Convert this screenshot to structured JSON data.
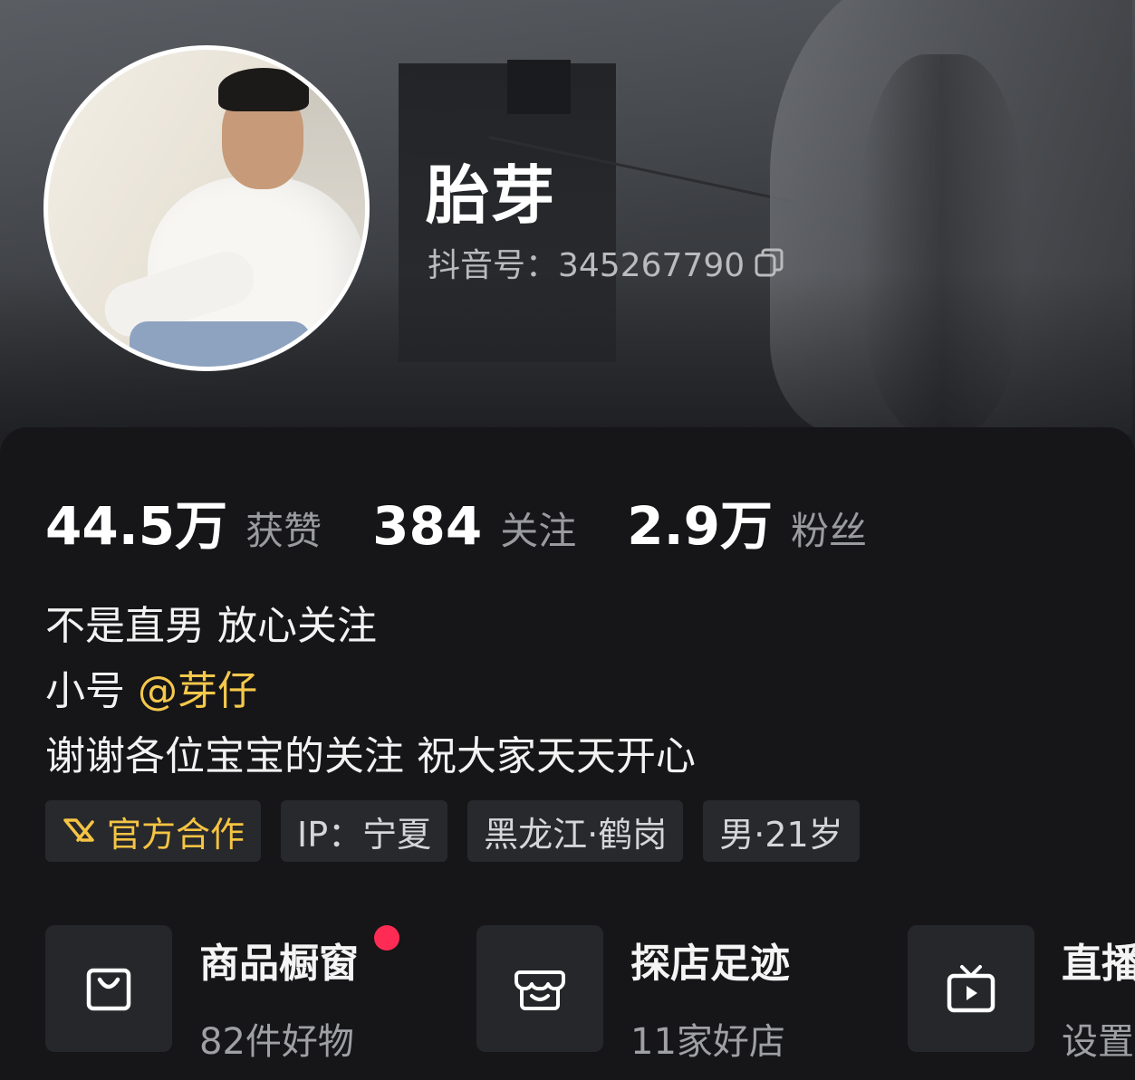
{
  "profile": {
    "nickname": "胎芽",
    "douyin_id_label": "抖音号：345267790"
  },
  "stats": [
    {
      "value": "44.5万",
      "label": "获赞"
    },
    {
      "value": "384",
      "label": "关注"
    },
    {
      "value": "2.9万",
      "label": "粉丝"
    }
  ],
  "bio": {
    "line1": "不是直男 放心关注",
    "line2_prefix": "小号 ",
    "line2_mention": "@芽仔",
    "line3": "谢谢各位宝宝的关注 祝大家天天开心"
  },
  "tags": {
    "official": "官方合作",
    "ip": "IP：宁夏",
    "location": "黑龙江·鹤岗",
    "gender_age": "男·21岁"
  },
  "features": [
    {
      "title": "商品橱窗",
      "sub": "82件好物",
      "icon": "shopping-bag-icon",
      "has_badge": true
    },
    {
      "title": "探店足迹",
      "sub": "11家好店",
      "icon": "store-icon",
      "has_badge": false
    },
    {
      "title": "直播",
      "sub": "设置",
      "icon": "tv-play-icon",
      "has_badge": false
    }
  ],
  "colors": {
    "accent_yellow": "#f6c84b",
    "badge_red": "#fe2c55",
    "background": "#161618"
  }
}
